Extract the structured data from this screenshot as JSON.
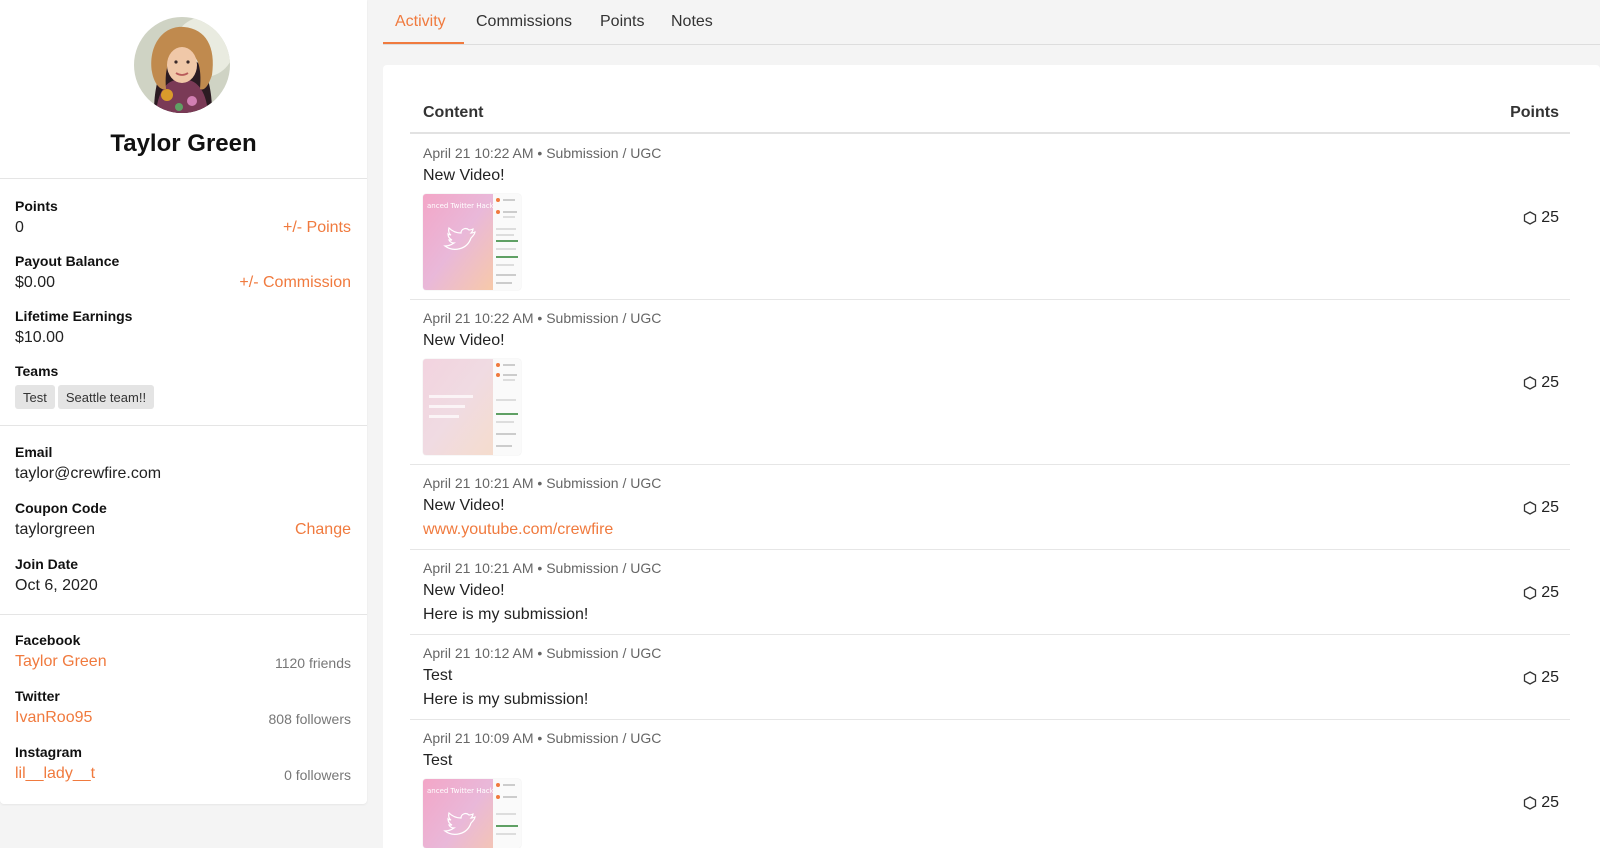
{
  "profile": {
    "name": "Taylor Green"
  },
  "stats": {
    "points_label": "Points",
    "points_value": "0",
    "points_action": "+/- Points",
    "payout_label": "Payout Balance",
    "payout_value": "$0.00",
    "payout_action": "+/- Commission",
    "lifetime_label": "Lifetime Earnings",
    "lifetime_value": "$10.00",
    "teams_label": "Teams",
    "teams": [
      "Test",
      "Seattle team!!"
    ]
  },
  "details": {
    "email_label": "Email",
    "email_value": "taylor@crewfire.com",
    "coupon_label": "Coupon Code",
    "coupon_value": "taylorgreen",
    "coupon_action": "Change",
    "join_label": "Join Date",
    "join_value": "Oct 6, 2020"
  },
  "social": {
    "facebook_label": "Facebook",
    "facebook_handle": "Taylor Green",
    "facebook_count": "1120 friends",
    "twitter_label": "Twitter",
    "twitter_handle": "IvanRoo95",
    "twitter_count": "808 followers",
    "instagram_label": "Instagram",
    "instagram_handle": "lil__lady__t",
    "instagram_count": "0 followers"
  },
  "tabs": [
    "Activity",
    "Commissions",
    "Points",
    "Notes"
  ],
  "table": {
    "col_content": "Content",
    "col_points": "Points"
  },
  "rows": [
    {
      "meta": "April 21 10:22 AM • Submission / UGC",
      "title": "New Video!",
      "points": "25",
      "thumbnail_text": "anced Twitter Hacks!"
    },
    {
      "meta": "April 21 10:22 AM • Submission / UGC",
      "title": "New Video!",
      "points": "25"
    },
    {
      "meta": "April 21 10:21 AM • Submission / UGC",
      "title": "New Video!",
      "sub": "www.youtube.com/crewfire",
      "points": "25"
    },
    {
      "meta": "April 21 10:21 AM • Submission / UGC",
      "title": "New Video!",
      "sub": "Here is my submission!",
      "points": "25"
    },
    {
      "meta": "April 21 10:12 AM • Submission / UGC",
      "title": "Test",
      "sub": "Here is my submission!",
      "points": "25"
    },
    {
      "meta": "April 21 10:09 AM • Submission / UGC",
      "title": "Test",
      "points": "25",
      "thumbnail_text": "anced Twitter Hacks!"
    }
  ],
  "icons": {
    "points_icon": "hexagon-icon",
    "thumbnail_icon": "twitter-bird-icon"
  },
  "colors": {
    "accent": "#f07a3e",
    "panel_bg": "#ffffff",
    "page_bg": "#f4f4f4"
  }
}
